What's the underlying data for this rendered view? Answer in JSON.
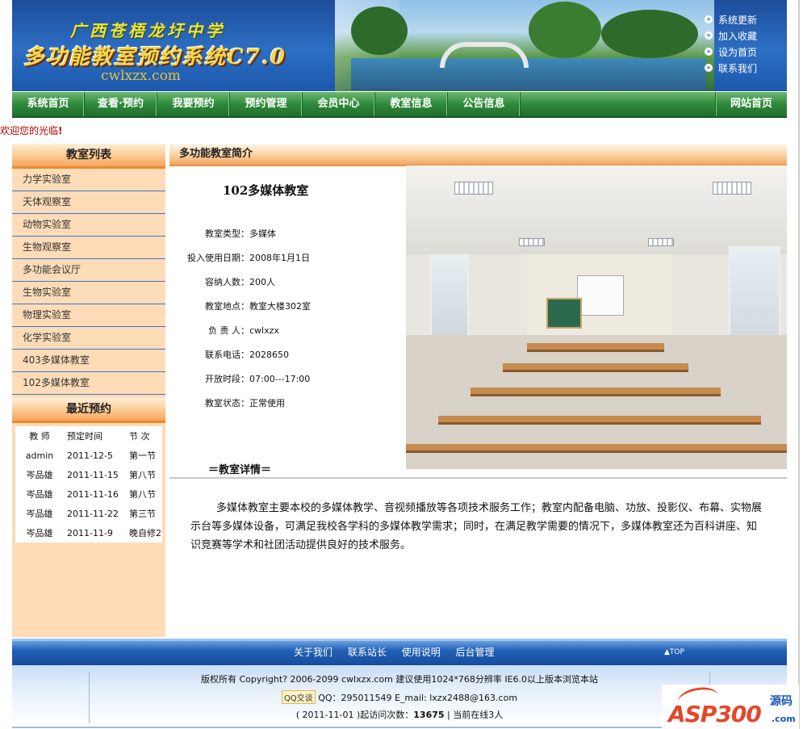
{
  "header": {
    "school": "广西苍梧龙圩中学",
    "system_title": "多功能教室预约系统C7.0",
    "site_url": "cwlxzx.com",
    "top_links": [
      "系统更新",
      "加入收藏",
      "设为首页",
      "联系我们"
    ]
  },
  "nav": {
    "items": [
      "系统首页",
      "查看·预约",
      "我要预约",
      "预约管理",
      "会员中心",
      "教室信息",
      "公告信息"
    ],
    "home": "网站首页"
  },
  "welcome": {
    "text": "欢迎您的光临",
    "mark": "!"
  },
  "sidebar": {
    "rooms_title": "教室列表",
    "rooms": [
      "力学实验室",
      "天体观察室",
      "动物实验室",
      "生物观察室",
      "多功能会议厅",
      "生物实验室",
      "物理实验室",
      "化学实验室",
      "403多媒体教室",
      "102多媒体教室"
    ],
    "bookings_title": "最近预约",
    "booking_headers": [
      "教 师",
      "预定时间",
      "节 次"
    ],
    "bookings": [
      [
        "admin",
        "2011-12-5",
        "第一节"
      ],
      [
        "岑品雄",
        "2011-11-15",
        "第八节"
      ],
      [
        "岑品雄",
        "2011-11-16",
        "第八节"
      ],
      [
        "岑品雄",
        "2011-11-22",
        "第三节"
      ],
      [
        "岑品雄",
        "2011-11-9",
        "晚自修2"
      ]
    ]
  },
  "content": {
    "section_title": "多功能教室简介",
    "room_name": "102多媒体教室",
    "info": [
      {
        "k": "教室类型：",
        "v": "多媒体"
      },
      {
        "k": "投入使用日期：",
        "v": "2008年1月1日"
      },
      {
        "k": "容纳人数：",
        "v": "200人"
      },
      {
        "k": "教室地点：",
        "v": "教室大楼302室"
      },
      {
        "k": "负 责 人：",
        "v": "cwlxzx"
      },
      {
        "k": "联系电话：",
        "v": "2028650"
      },
      {
        "k": "开放时段：",
        "v": "07:00---17:00"
      },
      {
        "k": "教室状态：",
        "v": "正常使用"
      }
    ],
    "detail_title": "＝教室详情＝",
    "description": "多媒体教室主要本校的多媒体教学、音视频播放等各项技术服务工作；教室内配备电脑、功放、投影仪、布幕、实物展示台等多媒体设备，可满足我校各学科的多媒体教学需求；同时，在满足教学需要的情况下，多媒体教室还为百科讲座、知识竞赛等学术和社团活动提供良好的技术服务。"
  },
  "footer": {
    "links": [
      "关于我们",
      "联系站长",
      "使用说明",
      "后台管理"
    ],
    "top": "▲TOP",
    "copyright": "版权所有 Copyright? 2006-2099 cwlxzx.com 建议使用1024*768分辨率 IE6.0以上版本浏览本站",
    "qq_badge": "QQ交谈",
    "contact": "QQ：295011549  E_mail: lxzx2488@163.com",
    "stats_prefix": "( 2011-11-01 )起访问次数：",
    "visits": "13675",
    "stats_suffix": " | 当前在线3人"
  },
  "watermark": {
    "brand": "ASP300",
    "cn": "源码",
    "domain": ".com"
  }
}
